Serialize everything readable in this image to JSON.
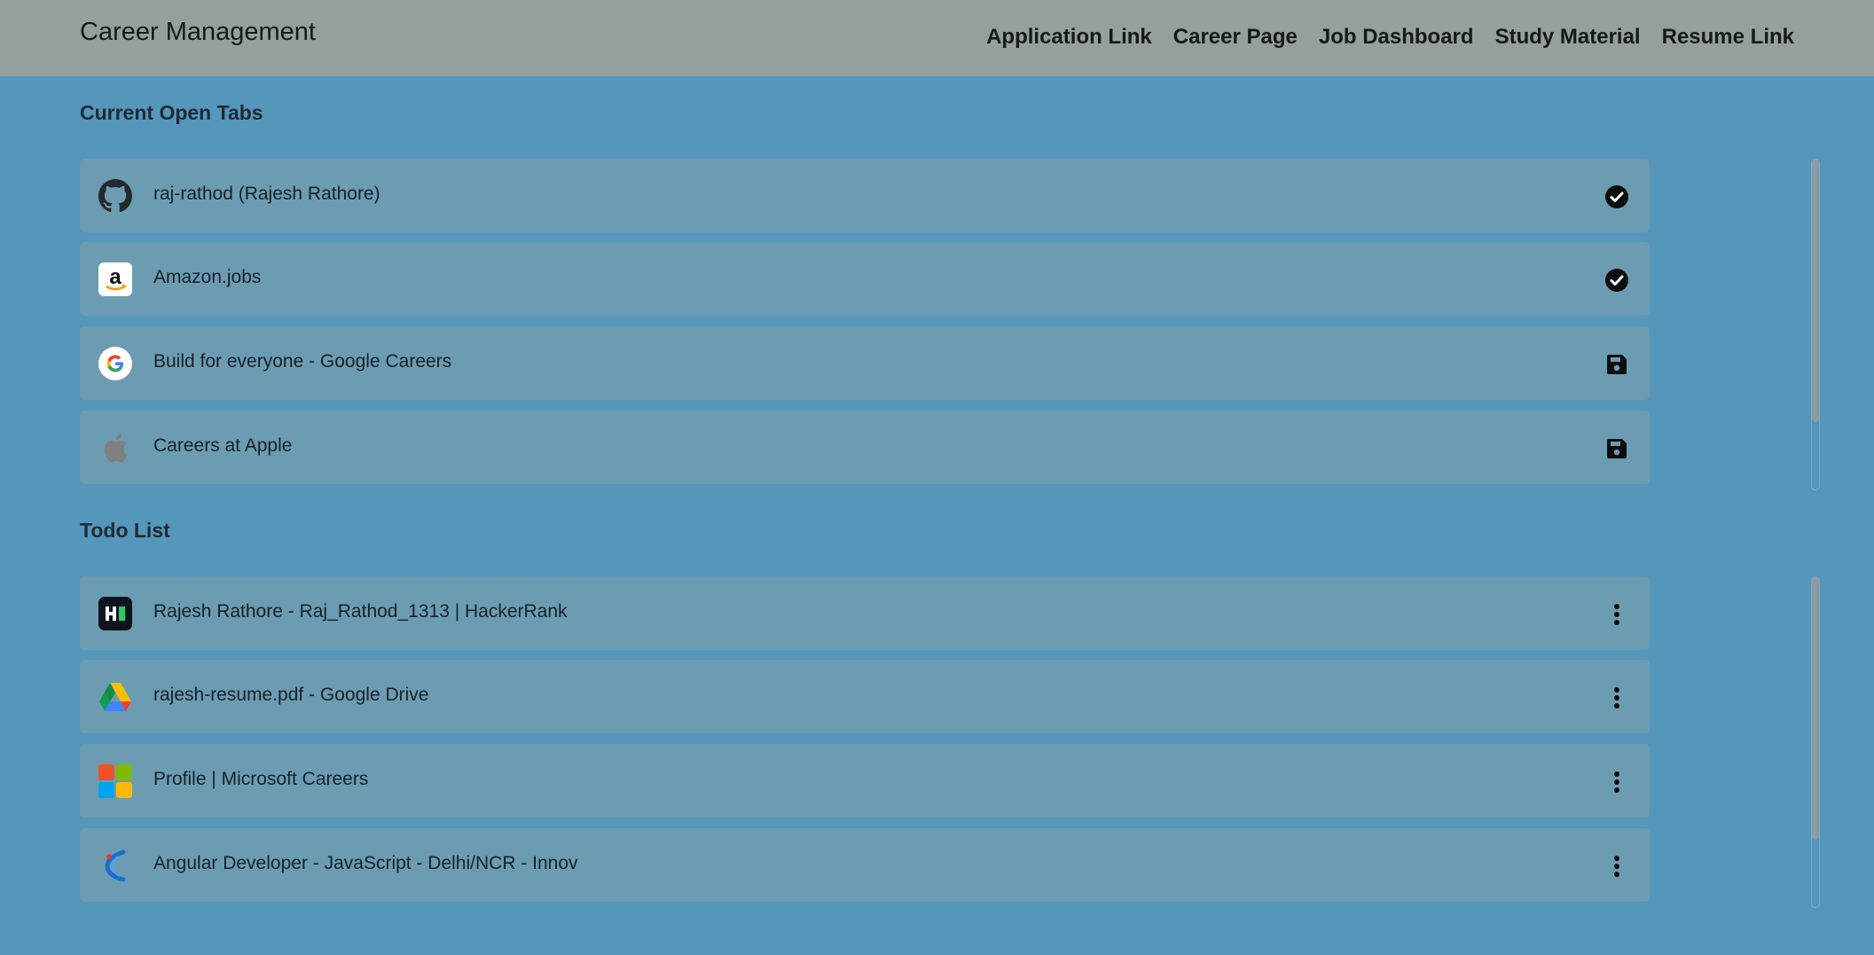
{
  "navbar": {
    "brand": "Career Management",
    "links": [
      "Application Link",
      "Career Page",
      "Job Dashboard",
      "Study Material",
      "Resume Link"
    ]
  },
  "open_tabs": {
    "title": "Current Open Tabs",
    "items": [
      {
        "label": "raj-rathod (Rajesh Rathore)",
        "icon": "github-icon",
        "action": "check-circle-icon"
      },
      {
        "label": "Amazon.jobs",
        "icon": "amazon-icon",
        "action": "check-circle-icon"
      },
      {
        "label": "Build for everyone - Google Careers",
        "icon": "google-icon",
        "action": "save-icon"
      },
      {
        "label": "Careers at Apple",
        "icon": "apple-icon",
        "action": "save-icon"
      }
    ]
  },
  "todo": {
    "title": "Todo List",
    "items": [
      {
        "label": "Rajesh Rathore - Raj_Rathod_1313 | HackerRank",
        "icon": "hackerrank-icon",
        "action": "more-vertical-icon"
      },
      {
        "label": "rajesh-resume.pdf - Google Drive",
        "icon": "google-drive-icon",
        "action": "more-vertical-icon"
      },
      {
        "label": "Profile | Microsoft Careers",
        "icon": "microsoft-icon",
        "action": "more-vertical-icon"
      },
      {
        "label": "Angular Developer - JavaScript - Delhi/NCR - Innov",
        "icon": "naukri-icon",
        "action": "more-vertical-icon"
      }
    ]
  },
  "colors": {
    "background": "#5596bb",
    "navbar": "#969f9b",
    "card": "#6c9cb1"
  }
}
